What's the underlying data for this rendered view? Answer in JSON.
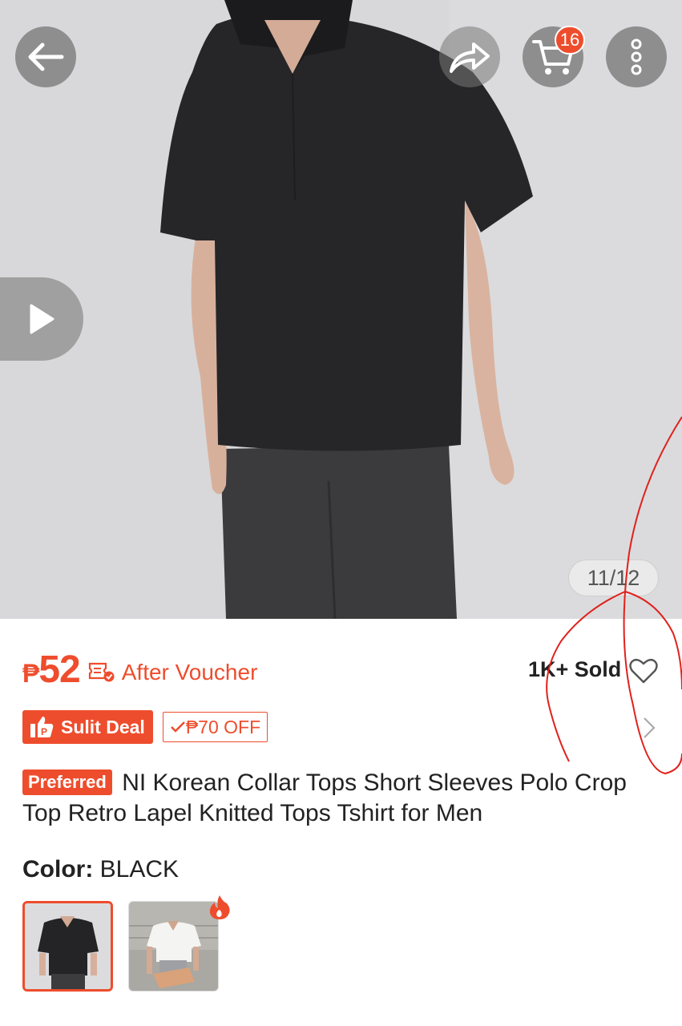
{
  "header": {
    "back_icon": "arrow-left-icon",
    "share_icon": "share-icon",
    "cart_icon": "cart-icon",
    "cart_count": "16",
    "more_icon": "more-vertical-icon"
  },
  "gallery": {
    "video_icon": "play-icon",
    "counter": "11/12"
  },
  "product": {
    "currency": "₱",
    "price": "52",
    "voucher_icon": "voucher-check-icon",
    "price_note": "After Voucher",
    "sold": "1K+ Sold",
    "wishlist_icon": "heart-outline-icon",
    "deal_label": "Sulit Deal",
    "discount_tag": "₱70 OFF",
    "badge": "Preferred",
    "title": "NI Korean Collar Tops Short Sleeves Polo Crop Top Retro Lapel Knitted Tops Tshirt for Men"
  },
  "variants": {
    "label": "Color:",
    "selected": "BLACK",
    "options": [
      "BLACK",
      "WHITE"
    ]
  },
  "colors": {
    "accent": "#ee4d2d",
    "text": "#222222",
    "annotation": "#e0211c"
  }
}
